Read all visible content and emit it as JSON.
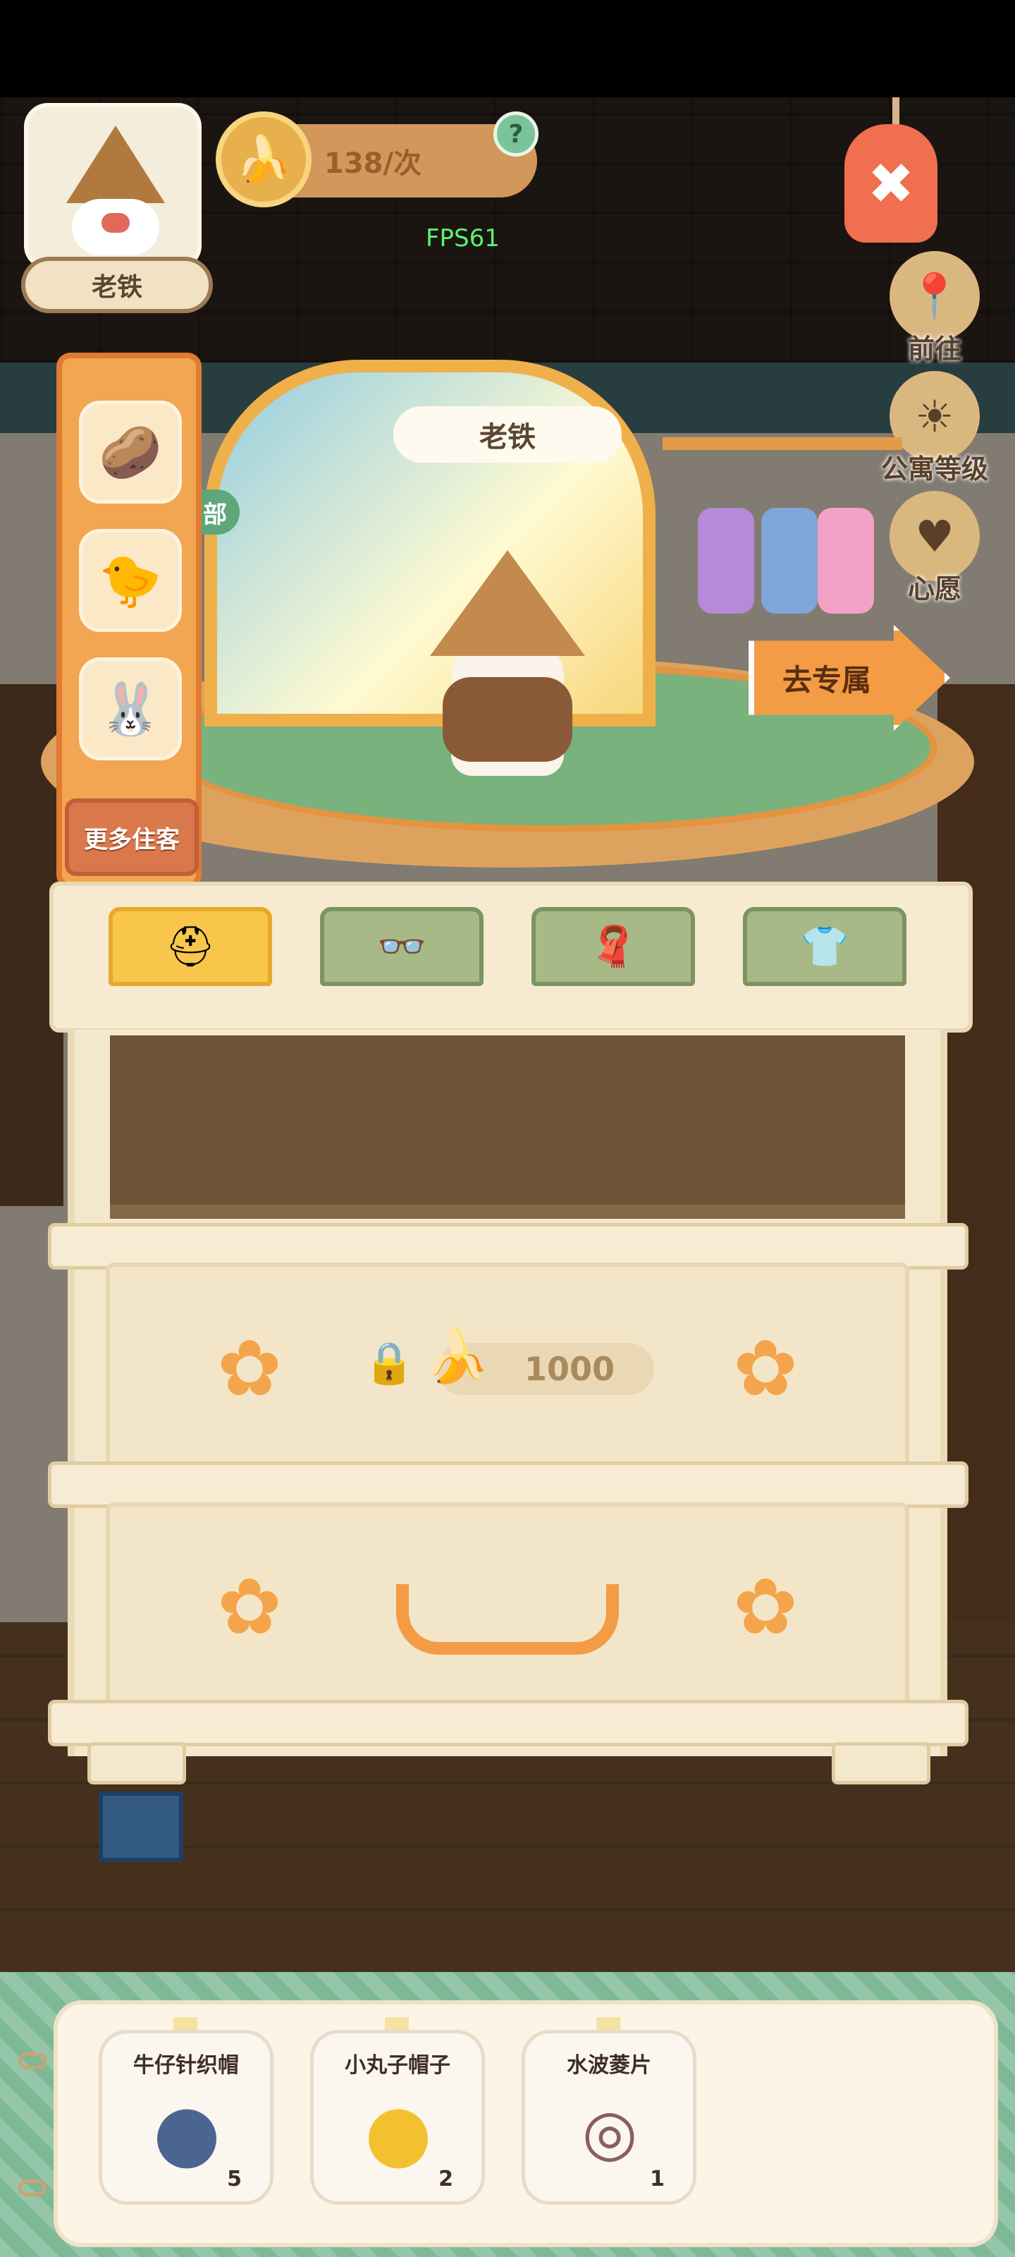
{
  "resident": {
    "name": "老铁",
    "stage_name": "老铁"
  },
  "currency": {
    "label": "138/次",
    "help": "?"
  },
  "debug": {
    "fps": "FPS61"
  },
  "close": {
    "symbol": "✖"
  },
  "right_menu": [
    {
      "label": "前往",
      "icon": "map-pin-icon"
    },
    {
      "label": "公寓等级",
      "icon": "sun-badge-icon"
    },
    {
      "label": "心愿",
      "icon": "heart-icon"
    }
  ],
  "resident_list": {
    "tag": "部",
    "more_label": "更多住客"
  },
  "go_button": {
    "label": "去专属"
  },
  "tabs": [
    {
      "icon": "hat-icon",
      "active": true
    },
    {
      "icon": "glasses-icon",
      "active": false
    },
    {
      "icon": "scarf-icon",
      "active": false
    },
    {
      "icon": "shirt-icon",
      "active": false
    }
  ],
  "locked_drawer": {
    "price": "1000"
  },
  "items": [
    {
      "name": "牛仔针织帽",
      "count": "5",
      "icon": "knit-hat-icon",
      "color": "#4a6590"
    },
    {
      "name": "小丸子帽子",
      "count": "2",
      "icon": "yellow-cap-icon",
      "color": "#f3c12f"
    },
    {
      "name": "水波菱片",
      "count": "1",
      "icon": "necklace-icon",
      "color": "#8a5f5b"
    }
  ],
  "colors": {
    "accent": "#f39c45",
    "active_tab": "#f7c64b",
    "inactive_tab": "#a7b986"
  }
}
